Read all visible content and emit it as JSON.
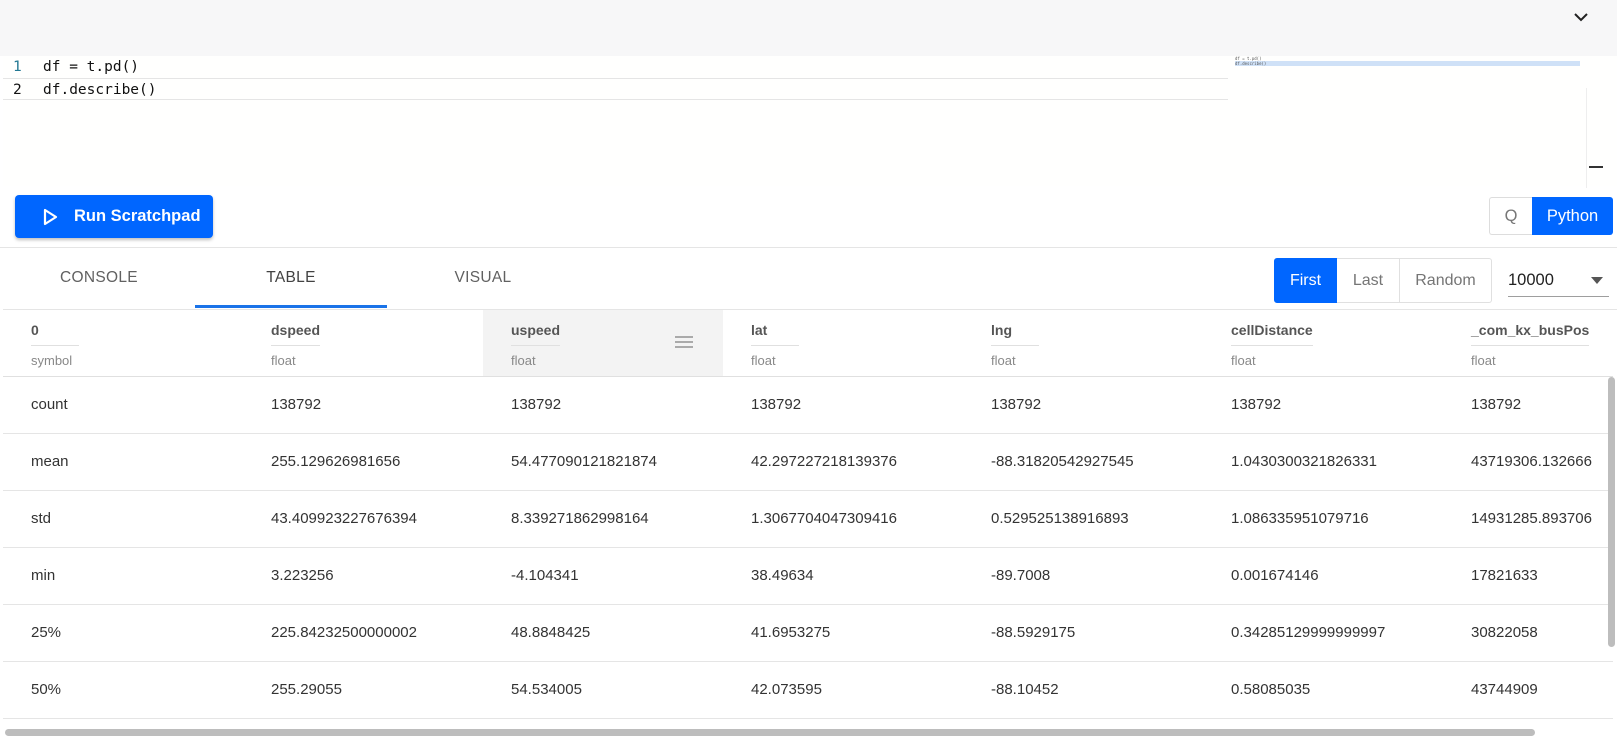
{
  "editor": {
    "lines": [
      {
        "number": "1",
        "code": "df = t.pd()"
      },
      {
        "number": "2",
        "code": "df.describe()"
      }
    ]
  },
  "toolbar": {
    "run_label": "Run Scratchpad",
    "languages": [
      "Q",
      "Python"
    ],
    "selected_language": "Python"
  },
  "tabs": [
    "CONSOLE",
    "TABLE",
    "VISUAL"
  ],
  "active_tab": "TABLE",
  "paging": {
    "buttons": [
      "First",
      "Last",
      "Random"
    ],
    "selected": "First",
    "rows_value": "10000"
  },
  "table": {
    "columns": [
      {
        "name": "0",
        "type": "symbol"
      },
      {
        "name": "dspeed",
        "type": "float"
      },
      {
        "name": "uspeed",
        "type": "float"
      },
      {
        "name": "lat",
        "type": "float"
      },
      {
        "name": "lng",
        "type": "float"
      },
      {
        "name": "cellDistance",
        "type": "float"
      },
      {
        "name": "_com_kx_busPos",
        "type": "float"
      }
    ],
    "rows": [
      [
        "count",
        "138792",
        "138792",
        "138792",
        "138792",
        "138792",
        "138792"
      ],
      [
        "mean",
        "255.129626981656",
        "54.477090121821874",
        "42.297227218139376",
        "-88.31820542927545",
        "1.0430300321826331",
        "43719306.132666"
      ],
      [
        "std",
        "43.409923227676394",
        "8.339271862998164",
        "1.3067704047309416",
        "0.529525138916893",
        "1.086335951079716",
        "14931285.893706"
      ],
      [
        "min",
        "3.223256",
        "-4.104341",
        "38.49634",
        "-89.7008",
        "0.001674146",
        "17821633"
      ],
      [
        "25%",
        "225.84232500000002",
        "48.8848425",
        "41.6953275",
        "-88.5929175",
        "0.34285129999999997",
        "30822058"
      ],
      [
        "50%",
        "255.29055",
        "54.534005",
        "42.073595",
        "-88.10452",
        "0.58085035",
        "43744909"
      ]
    ]
  },
  "colors": {
    "accent": "#0066ff",
    "tab_underline": "#1a73e8"
  }
}
